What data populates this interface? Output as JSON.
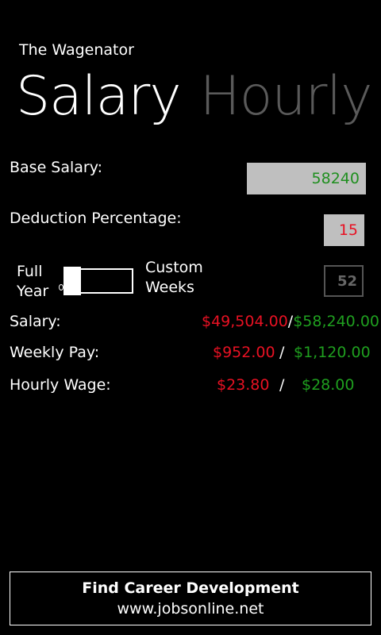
{
  "app": {
    "title": "The Wagenator"
  },
  "pivot": {
    "active": "Salary",
    "inactive": "Hourly"
  },
  "form": {
    "base_salary_label": "Base Salary:",
    "base_salary_value": "58240",
    "deduction_label": "Deduction Percentage:",
    "deduction_value": "15"
  },
  "toggle": {
    "left_label_line1": "Full",
    "left_label_line2": "Year",
    "right_label_line1": "Custom",
    "right_label_line2": "Weeks",
    "weeks_value": "52",
    "state": "off"
  },
  "results": {
    "salary_label": "Salary:",
    "salary_net": "$49,504.00",
    "salary_gross": "$58,240.00",
    "weekly_label": "Weekly Pay:",
    "weekly_net": "$952.00",
    "weekly_gross": "$1,120.00",
    "hourly_label": "Hourly Wage:",
    "hourly_net": "$23.80",
    "hourly_gross": "$28.00",
    "separator": "/"
  },
  "footer": {
    "line1": "Find Career Development",
    "line2": "www.jobsonline.net"
  },
  "colors": {
    "net": "#e81123",
    "gross": "#1f9f1f",
    "inactive": "#5a5a5a"
  }
}
